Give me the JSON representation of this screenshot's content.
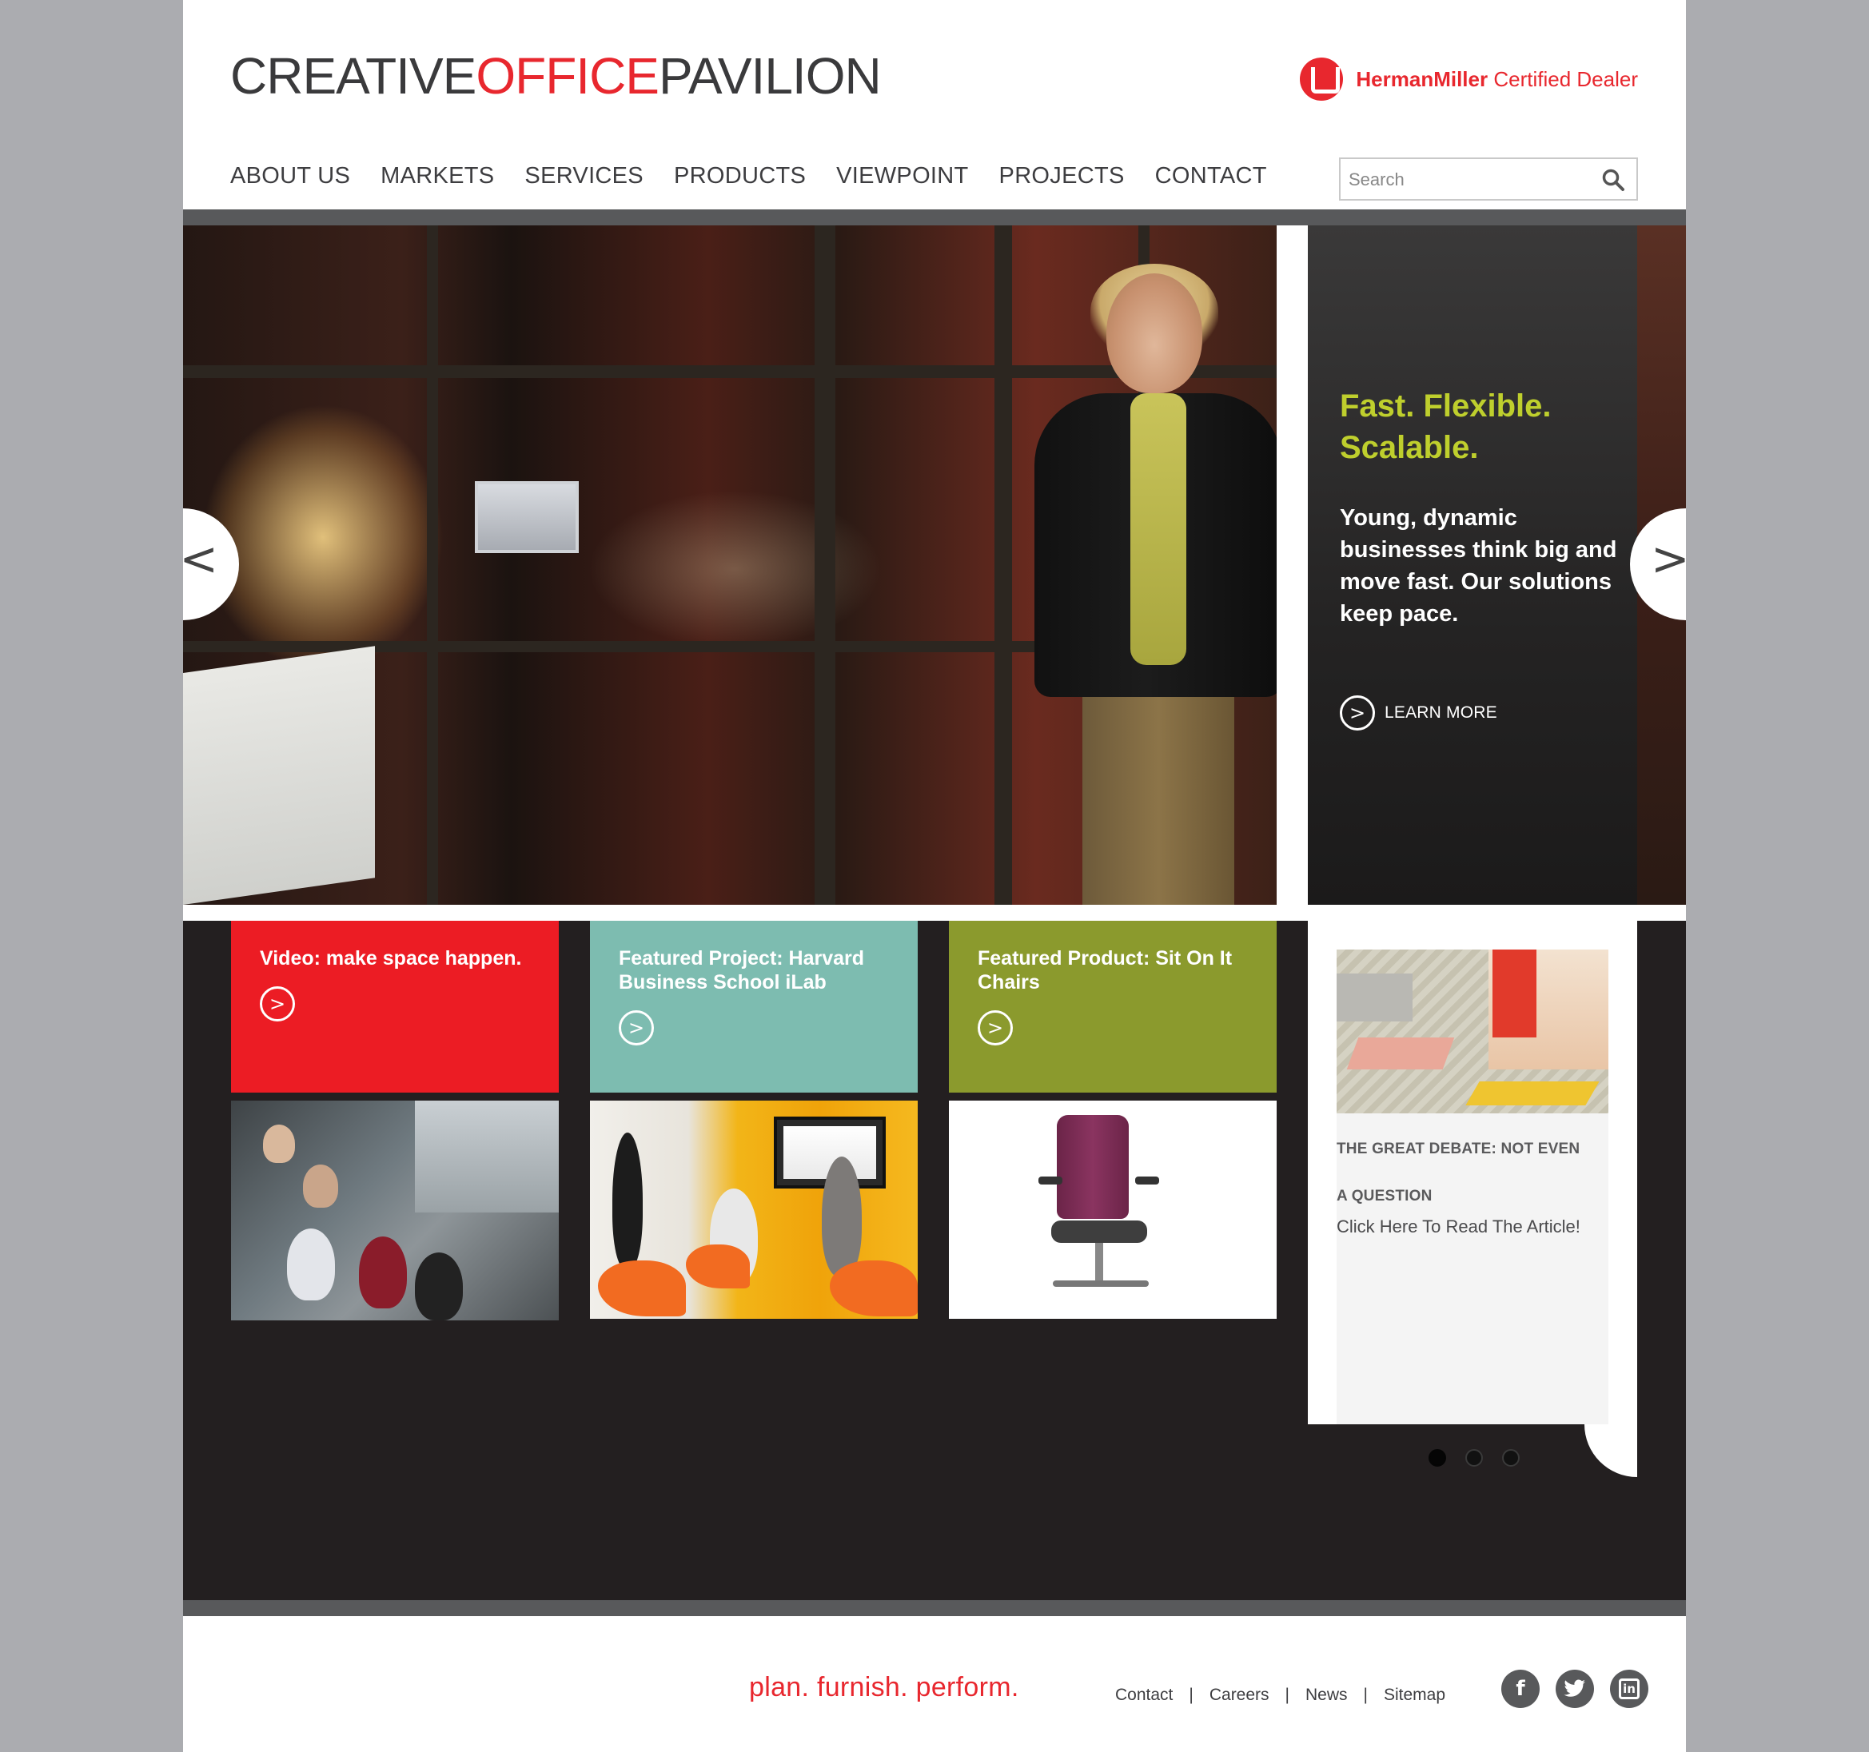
{
  "header": {
    "logo": {
      "part1": "CREATIVE",
      "part2": "OFFICE",
      "part3": "PAVILION"
    },
    "dealer": {
      "brand": "HermanMiller",
      "label": "Certified Dealer"
    },
    "nav": [
      "ABOUT US",
      "MARKETS",
      "SERVICES",
      "PRODUCTS",
      "VIEWPOINT",
      "PROJECTS",
      "CONTACT"
    ],
    "search": {
      "placeholder": "Search",
      "icon": "search-icon"
    }
  },
  "hero": {
    "headline": "Fast. Flexible. Scalable.",
    "body": "Young, dynamic businesses think big and move fast. Our solutions keep pace.",
    "cta": "LEARN MORE",
    "prev_arrow": "<",
    "next_arrow": ">",
    "headline_color": "#bfcf2d"
  },
  "cards": [
    {
      "title": "Video: make space happen.",
      "arrow": ">",
      "color": "#ec1c24"
    },
    {
      "title": "Featured Project: Harvard Business School iLab",
      "arrow": ">",
      "color": "#7dbcb0"
    },
    {
      "title": "Featured Product: Sit On It Chairs",
      "arrow": ">",
      "color": "#8b9a2d"
    }
  ],
  "article": {
    "title": "THE GREAT DEBATE: NOT EVEN A QUESTION",
    "link": "Click Here To Read The Article!"
  },
  "carousel": {
    "dots": 3,
    "active": 0
  },
  "footer": {
    "tagline": "plan. furnish. perform.",
    "links": [
      "Contact",
      "Careers",
      "News",
      "Sitemap"
    ],
    "social": [
      "facebook-icon",
      "twitter-icon",
      "linkedin-icon"
    ],
    "accent": "#e8272e"
  }
}
